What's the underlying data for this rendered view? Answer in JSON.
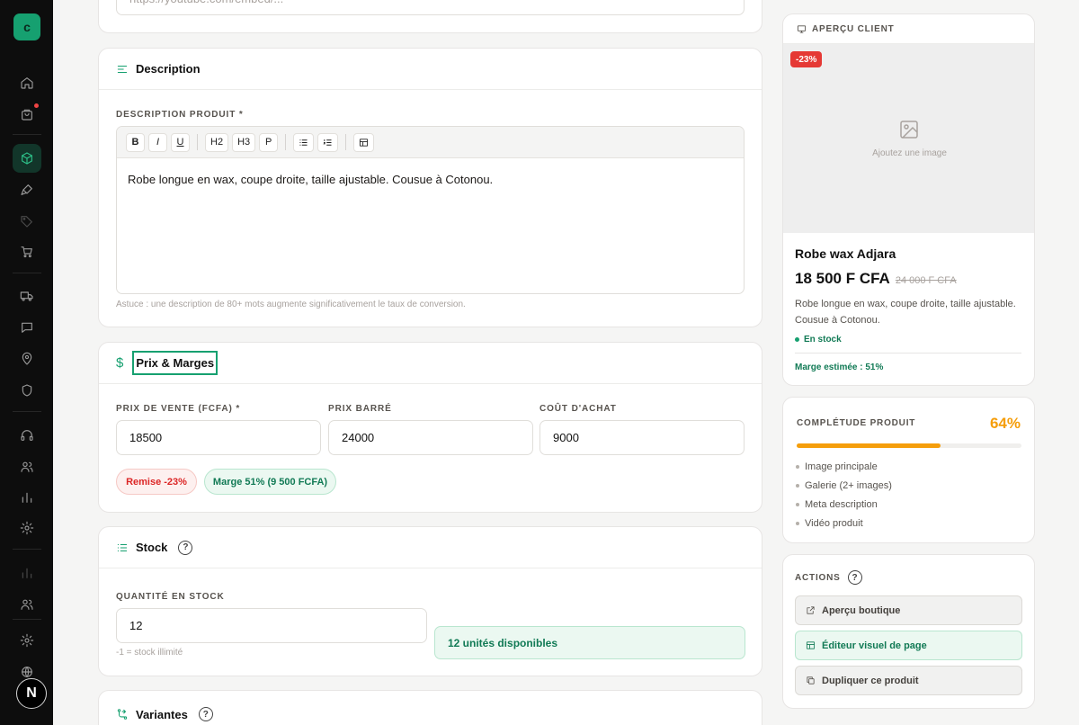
{
  "brand": {
    "logo_letter": "c"
  },
  "sidebar": {
    "user_avatar_letter": "N"
  },
  "embed_field": {
    "placeholder": "https://youtube.com/embed/..."
  },
  "description_card": {
    "title": "Description",
    "label": "DESCRIPTION PRODUIT *",
    "toolbar": {
      "bold": "B",
      "italic": "I",
      "underline": "U",
      "h2": "H2",
      "h3": "H3",
      "p": "P"
    },
    "content": "Robe longue en wax, coupe droite, taille ajustable. Cousue à Cotonou.",
    "tip": "Astuce : une description de 80+ mots augmente significativement le taux de conversion."
  },
  "pricing_card": {
    "title": "Prix & Marges",
    "sale_price_label": "PRIX DE VENTE (FCFA) *",
    "sale_price": "18500",
    "strike_price_label": "PRIX BARRÉ",
    "strike_price": "24000",
    "cost_label": "COÛT D'ACHAT",
    "cost": "9000",
    "discount_badge": "Remise -23%",
    "margin_badge": "Marge 51% (9 500 FCFA)"
  },
  "stock_card": {
    "title": "Stock",
    "help": "?",
    "quantity_label": "QUANTITÉ EN STOCK",
    "quantity": "12",
    "hint": "-1 = stock illimité",
    "available_text": "12 unités disponibles"
  },
  "variants_card": {
    "title": "Variantes",
    "help": "?"
  },
  "preview_card": {
    "title": "APERÇU CLIENT",
    "discount_tag": "-23%",
    "image_placeholder": "Ajoutez une image",
    "product_name": "Robe wax Adjara",
    "price": "18 500 F CFA",
    "old_price": "24 000 F CFA",
    "description": "Robe longue en wax, coupe droite, taille ajustable. Cousue à Cotonou.",
    "stock_status": "En stock",
    "margin": "Marge estimée : 51%"
  },
  "completeness_card": {
    "title": "COMPLÉTUDE PRODUIT",
    "percent_label": "64%",
    "progress": 0.64,
    "items": [
      "Image principale",
      "Galerie (2+ images)",
      "Meta description",
      "Vidéo produit"
    ]
  },
  "actions_card": {
    "title": "ACTIONS",
    "help": "?",
    "shop_preview": "Aperçu boutique",
    "visual_editor": "Éditeur visuel de page",
    "duplicate": "Dupliquer ce produit"
  },
  "colors": {
    "accent": "#16a070",
    "discount_red": "#dc2626",
    "progress_orange": "#f59e0b",
    "sidebar_bg": "#0d0d0d"
  }
}
